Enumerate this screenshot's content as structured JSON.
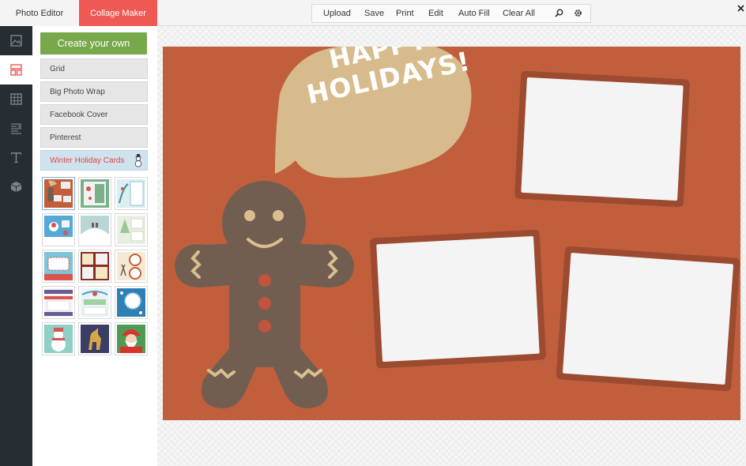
{
  "tabs": {
    "photo_editor": "Photo Editor",
    "collage_maker": "Collage Maker"
  },
  "toolbar": {
    "upload": "Upload",
    "save": "Save",
    "print": "Print",
    "edit": "Edit",
    "auto_fill": "Auto Fill",
    "clear_all": "Clear All",
    "zoom_icon": "search-icon",
    "settings_icon": "gear-icon"
  },
  "leftnav": {
    "items": [
      "image-icon",
      "layout-icon",
      "grid-icon",
      "texture-icon",
      "text-icon",
      "cube-icon"
    ],
    "active_index": 1
  },
  "panel": {
    "create_button": "Create your own",
    "categories": [
      "Grid",
      "Big Photo Wrap",
      "Facebook Cover",
      "Pinterest",
      "Winter Holiday Cards"
    ],
    "active_category": "Winter Holiday Cards",
    "category_icon": "snowman-icon",
    "template_count": 15
  },
  "canvas": {
    "greeting_line1": "HAPPY",
    "greeting_line2": "HOLIDAYS!",
    "photo_slots": 3
  },
  "colors": {
    "accent_tab": "#ef5953",
    "create_button": "#77a84a",
    "card_background": "#c15f3c",
    "frame": "#9c4a30",
    "bubble": "#d7bb8c",
    "gingerbread": "#725e50",
    "icing": "#d9bf8e",
    "buttons": "#c0543c",
    "nav_dark": "#262d33"
  }
}
